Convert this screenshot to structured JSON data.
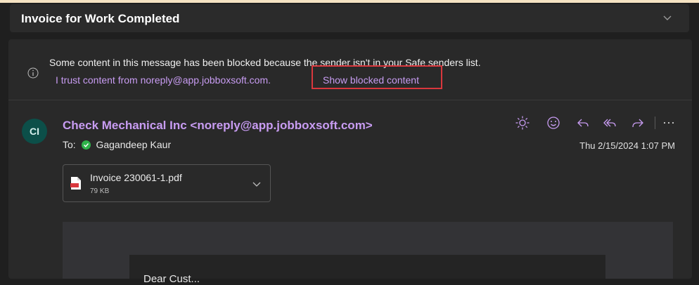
{
  "subject": "Invoice for Work Completed",
  "blocked_notice": {
    "message": "Some content in this message has been blocked because the sender isn't in your Safe senders list.",
    "trust_link": "I trust content from noreply@app.jobboxsoft.com.",
    "show_blocked": "Show blocked content"
  },
  "email": {
    "avatar_initials": "CI",
    "sender": "Check Mechanical Inc <noreply@app.jobboxsoft.com>",
    "to_label": "To:",
    "recipient": "Gagandeep Kaur",
    "timestamp": "Thu 2/15/2024 1:07 PM",
    "actions": [
      "sun-icon",
      "emoji-icon",
      "reply-icon",
      "reply-all-icon",
      "forward-icon",
      "more-icon"
    ]
  },
  "attachment": {
    "name": "Invoice 230061-1.pdf",
    "size": "79 KB"
  },
  "body": {
    "greeting": "Dear Cust..."
  },
  "colors": {
    "background": "#1f1f1f",
    "card": "#292929",
    "accent_link": "#c89cf2",
    "highlight_box": "#d9373d",
    "avatar": "#0c4f49",
    "presence_green": "#2fb34a"
  }
}
